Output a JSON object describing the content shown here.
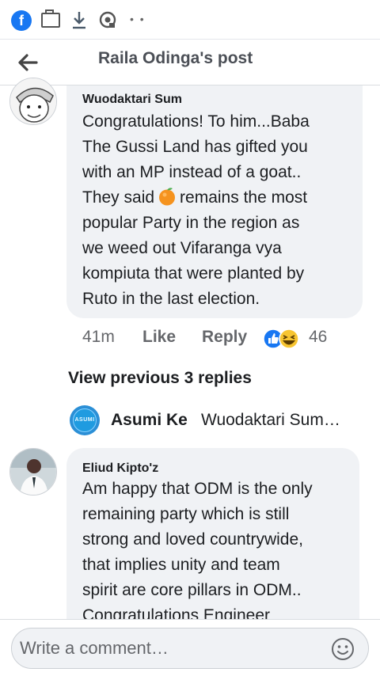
{
  "statusbar": {
    "icons": [
      "facebook-icon",
      "messages-icon",
      "download-icon",
      "podcast-icon",
      "more-dots-icon"
    ],
    "fb_letter": "f",
    "dots": "• •"
  },
  "header": {
    "title": "Raila Odinga's post"
  },
  "comment1": {
    "author": "Wuodaktari Sum",
    "lines": [
      "Congratulations! To him...Baba",
      "The Gussi Land has gifted you",
      "with an MP instead of a goat.."
    ],
    "line4_before": "They said",
    "line4_after": "remains the most",
    "lines_after": [
      "popular Party in the region as",
      "we weed out Vifaranga vya",
      "kompiuta that were planted by",
      "Ruto in the last election."
    ],
    "time": "41m",
    "like_label": "Like",
    "reply_label": "Reply",
    "reaction_count": "46",
    "reactions": [
      "like-icon",
      "haha-icon"
    ]
  },
  "view_previous": "View previous 3 replies",
  "reply_preview": {
    "avatar_text": "ASUMI",
    "name": "Asumi Ke",
    "snippet": "Wuodaktari Sum…"
  },
  "comment2": {
    "author": "Eliud Kipto'z",
    "text": "Am happy that ODM is the only\nremaining party which is still\nstrong and loved countrywide,\nthat implies unity and team\nspirit are core pillars in ODM..\nCongratulations Engineer"
  },
  "composer": {
    "placeholder": "Write a comment…"
  },
  "colors": {
    "brand": "#1877f2",
    "bubble": "#f0f2f5",
    "secondary_text": "#65676b"
  }
}
